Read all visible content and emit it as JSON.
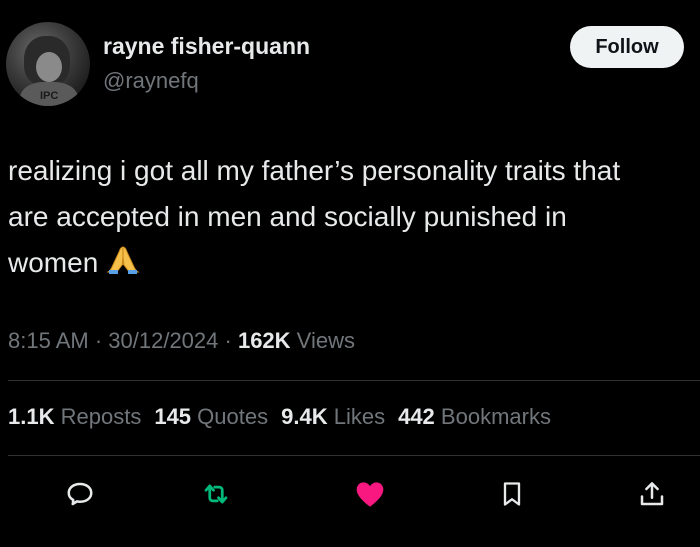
{
  "user": {
    "name": "rayne fisher-quann",
    "handle": "@raynefq",
    "avatar_label": "IPC"
  },
  "follow_label": "Follow",
  "tweet": {
    "line1": "realizing i got all my father’s personality traits that",
    "line2": "are accepted in men and socially punished in",
    "line3": "women",
    "emoji": "folded-hands-emoji"
  },
  "meta": {
    "time": "8:15 AM",
    "separator": " · ",
    "date": "30/12/2024",
    "views_count": "162K",
    "views_label": "Views"
  },
  "stats": {
    "reposts": {
      "count": "1.1K",
      "label": "Reposts"
    },
    "quotes": {
      "count": "145",
      "label": "Quotes"
    },
    "likes": {
      "count": "9.4K",
      "label": "Likes"
    },
    "bookmarks": {
      "count": "442",
      "label": "Bookmarks"
    }
  },
  "actions": {
    "reply_icon": "reply-icon",
    "repost_icon": "repost-icon",
    "like_icon": "heart-icon",
    "bookmark_icon": "bookmark-icon",
    "share_icon": "share-icon"
  },
  "colors": {
    "background": "#000000",
    "text": "#e7e9ea",
    "secondary": "#71767b",
    "repost_green": "#00ba7c",
    "like_pink": "#f91880",
    "divider": "#2f3336"
  }
}
